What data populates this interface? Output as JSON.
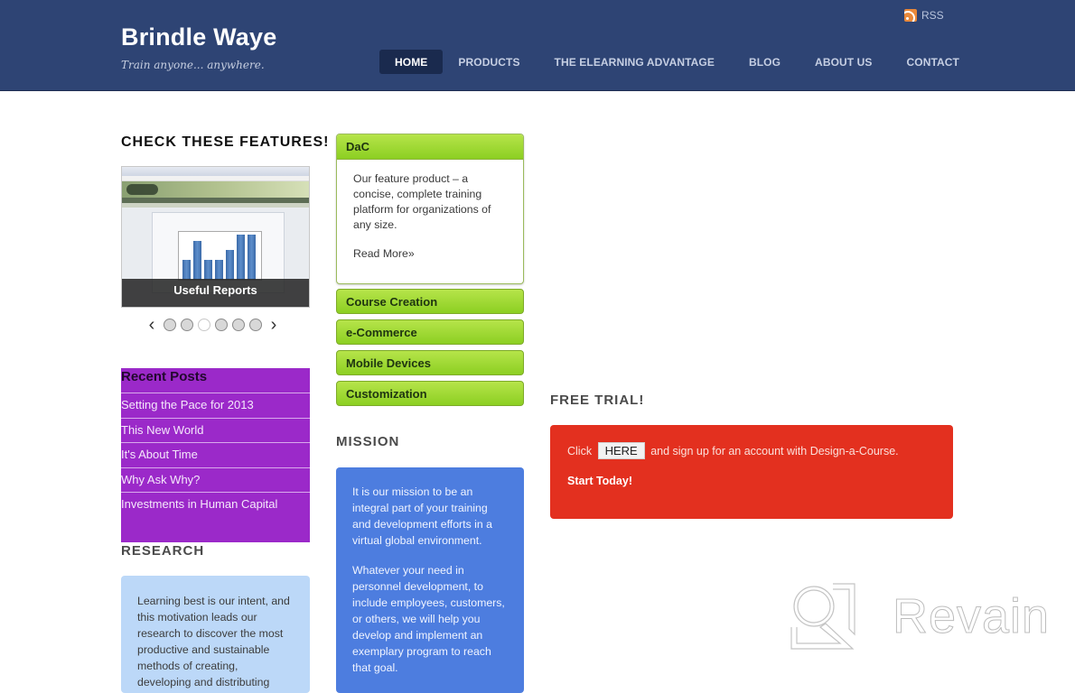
{
  "header": {
    "site_title": "Brindle Waye",
    "tagline": "Train anyone... anywhere.",
    "rss_label": "RSS",
    "nav": [
      {
        "label": "HOME",
        "active": true
      },
      {
        "label": "PRODUCTS",
        "active": false
      },
      {
        "label": "THE ELEARNING ADVANTAGE",
        "active": false
      },
      {
        "label": "BLOG",
        "active": false
      },
      {
        "label": "ABOUT US",
        "active": false
      },
      {
        "label": "CONTACT",
        "active": false
      }
    ]
  },
  "features": {
    "heading": "CHECK THESE FEATURES!",
    "slide_caption": "Useful Reports",
    "slide_count": 6,
    "active_slide_index": 3,
    "prev_icon": "chevron-left-icon",
    "next_icon": "chevron-right-icon"
  },
  "recent_posts": {
    "title": "Recent Posts",
    "items": [
      "Setting the Pace for 2013",
      "This New World",
      "It's About Time",
      "Why Ask Why?",
      "Investments in Human Capital"
    ]
  },
  "research": {
    "heading": "RESEARCH",
    "text": "Learning best is our intent, and this motivation leads our research to discover the most productive and sustainable methods of creating, developing and distributing"
  },
  "products_accordion": {
    "open": {
      "title": "DaC",
      "description": "Our feature product – a concise, complete training platform for organizations of any size.",
      "read_more": "Read More»"
    },
    "collapsed": [
      "Course Creation",
      "e-Commerce",
      "Mobile Devices",
      "Customization"
    ]
  },
  "mission": {
    "heading": "MISSION",
    "paragraphs": [
      "It is our mission to be an integral part of your training and development efforts in a virtual global environment.",
      "Whatever your need in personnel development, to include employees, customers, or others, we will help you develop and implement an exemplary program to reach that goal."
    ]
  },
  "free_trial": {
    "heading": "FREE TRIAL!",
    "click_text": "Click",
    "button_label": "HERE",
    "after_text": "and sign up for an account with Design-a-Course.",
    "cta": "Start Today!"
  },
  "watermark": {
    "text": "Revain"
  },
  "colors": {
    "header_bg": "#2e4474",
    "accordion_green": "#9ad530",
    "recent_posts_purple": "#9b29c9",
    "research_blue": "#bcd8f8",
    "mission_blue": "#4d7ddf",
    "trial_red": "#e3301f"
  }
}
